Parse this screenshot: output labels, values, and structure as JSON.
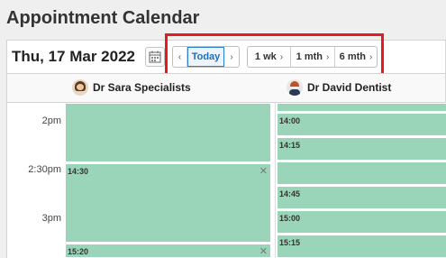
{
  "page": {
    "title": "Appointment Calendar"
  },
  "toolbar": {
    "date": "Thu, 17 Mar 2022",
    "today_label": "Today",
    "prev_glyph": "‹",
    "next_glyph": "›",
    "ranges": [
      {
        "label": "1 wk"
      },
      {
        "label": "1 mth"
      },
      {
        "label": "6 mth"
      }
    ]
  },
  "providers": [
    {
      "name": "Dr Sara Specialists"
    },
    {
      "name": "Dr David Dentist"
    }
  ],
  "time_labels": [
    "2pm",
    "2:30pm",
    "3pm"
  ],
  "column1_appointments": [
    {
      "time": ""
    },
    {
      "time": "14:30"
    },
    {
      "time": "15:20"
    }
  ],
  "column2_appointments": [
    {
      "time": ""
    },
    {
      "time": "14:00"
    },
    {
      "time": "14:15"
    },
    {
      "time": ""
    },
    {
      "time": "14:45"
    },
    {
      "time": "15:00"
    },
    {
      "time": "15:15"
    },
    {
      "time": ""
    }
  ],
  "colors": {
    "appointment": "#9bd5b9",
    "today_accent": "#1c6fb8",
    "highlight": "#e8191e"
  }
}
